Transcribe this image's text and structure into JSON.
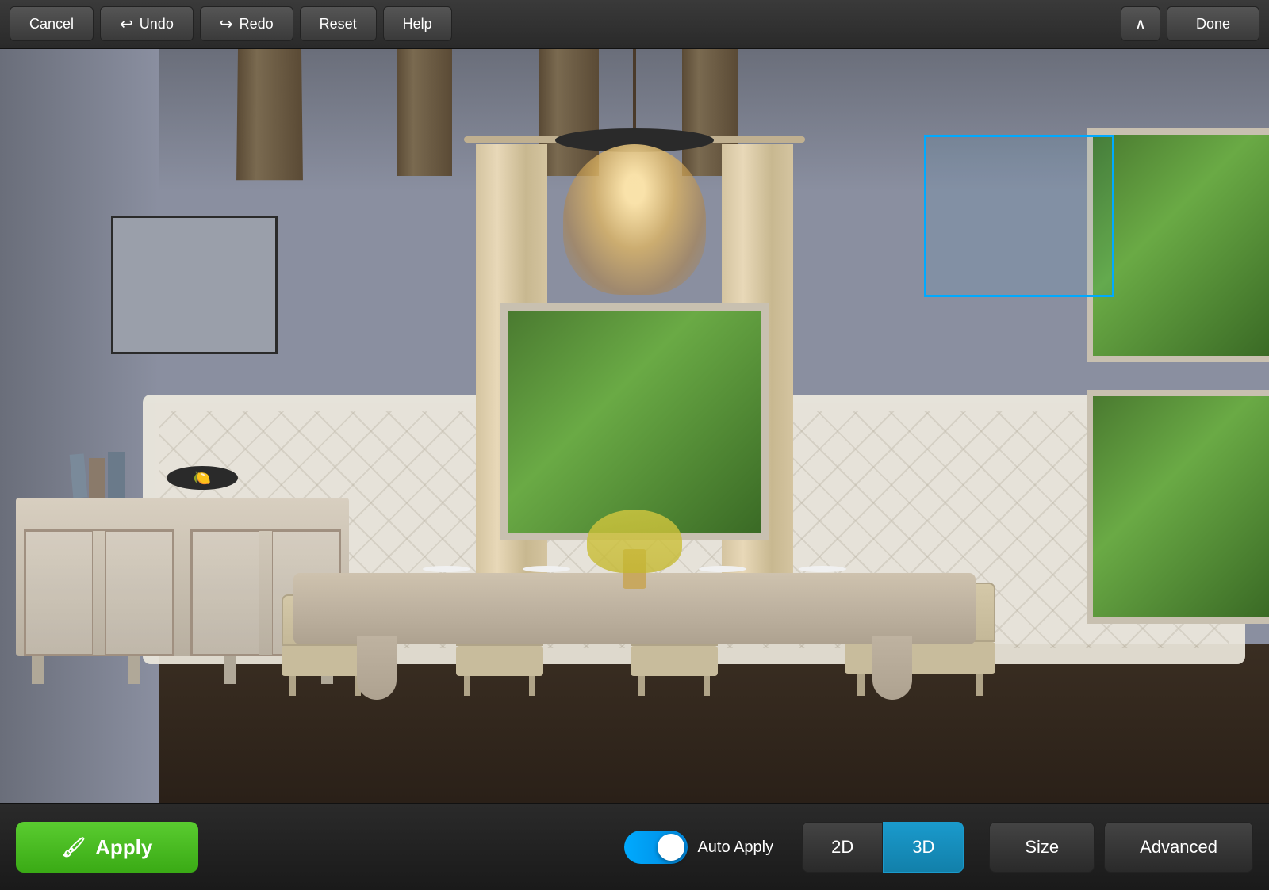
{
  "toolbar": {
    "cancel_label": "Cancel",
    "undo_label": "Undo",
    "redo_label": "Redo",
    "reset_label": "Reset",
    "help_label": "Help",
    "done_label": "Done"
  },
  "bottom_bar": {
    "apply_label": "Apply",
    "auto_apply_label": "Auto Apply",
    "view_2d_label": "2D",
    "view_3d_label": "3D",
    "size_label": "Size",
    "advanced_label": "Advanced",
    "active_view": "3D"
  },
  "scene": {
    "selection_box_color": "#00aaff",
    "picture_frame_visible": true
  },
  "icons": {
    "undo": "↩",
    "redo": "↪",
    "chevron_up": "∧",
    "apply_paint": "🖌"
  }
}
